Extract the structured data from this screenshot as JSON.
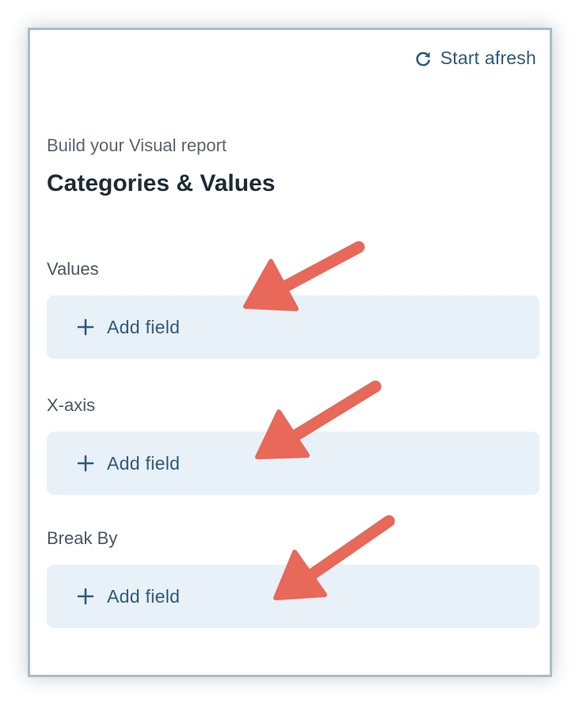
{
  "header": {
    "reset_label": "Start afresh",
    "reset_icon": "refresh-icon"
  },
  "report": {
    "subtitle": "Build your Visual report",
    "title": "Categories & Values"
  },
  "sections": [
    {
      "label": "Values",
      "add_label": "Add field",
      "icon": "plus-icon"
    },
    {
      "label": "X-axis",
      "add_label": "Add field",
      "icon": "plus-icon"
    },
    {
      "label": "Break By",
      "add_label": "Add field",
      "icon": "plus-icon"
    }
  ],
  "annotations": {
    "arrow_color": "#e8685a",
    "arrow_count": 3
  },
  "colors": {
    "accent": "#2f5a7a",
    "field_background": "#e8f1f8",
    "panel_border": "#a9bcc7"
  }
}
